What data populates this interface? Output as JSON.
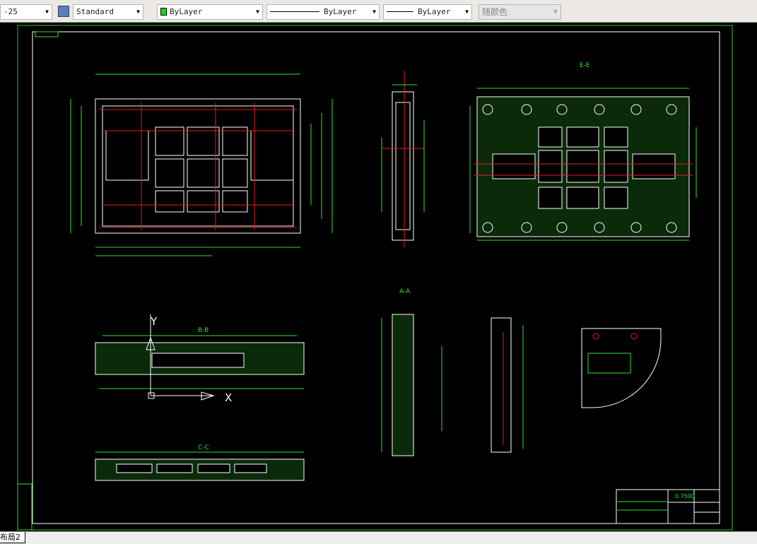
{
  "toolbar": {
    "dimstyle": "-25",
    "textstyle": "Standard",
    "color": "ByLayer",
    "linetype": "ByLayer",
    "lineweight": "ByLayer",
    "plotstyle": "随颜色",
    "color_swatch": "#00e000"
  },
  "drawing": {
    "title_code": "0.7500",
    "section_labels": [
      "E-E",
      "A-A",
      "B-B",
      "C-C"
    ],
    "axis_y": "Y",
    "axis_x": "X"
  },
  "layout_tabs": [
    {
      "label": "布局2"
    }
  ]
}
